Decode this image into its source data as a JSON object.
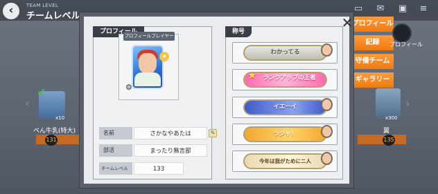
{
  "header": {
    "small": "TEAM LEVEL",
    "title": "チームレベル"
  },
  "side_tabs": [
    {
      "label": "プロフィール"
    },
    {
      "label": "記録"
    },
    {
      "label": "守備チーム"
    },
    {
      "label": "ギャラリー"
    }
  ],
  "avatar_label": "プロフィール",
  "background_items": {
    "left": {
      "name": "べん牛乳(特大)",
      "count": "x10",
      "level": "131"
    },
    "right": {
      "name": "翼",
      "count": "x300",
      "level": "135"
    }
  },
  "modal": {
    "profile_header": "プロフィール",
    "titles_header": "称号",
    "player_frame_label": "プロフィールプレイヤー",
    "rows": {
      "name_label": "名前",
      "name_value": "さかなやあたは",
      "club_label": "部活",
      "club_value": "まったり無言部",
      "level_label": "チームレベル",
      "level_value": "133"
    },
    "titles": [
      {
        "text": "わかってる"
      },
      {
        "text": "ランクアップの王者"
      },
      {
        "text": "イエーイ"
      },
      {
        "text": "ラジャ！"
      },
      {
        "text": "今年は我がためにニ人"
      }
    ]
  },
  "colors": {
    "accent": "#ef7a10",
    "header_dark": "#3a3e46"
  }
}
